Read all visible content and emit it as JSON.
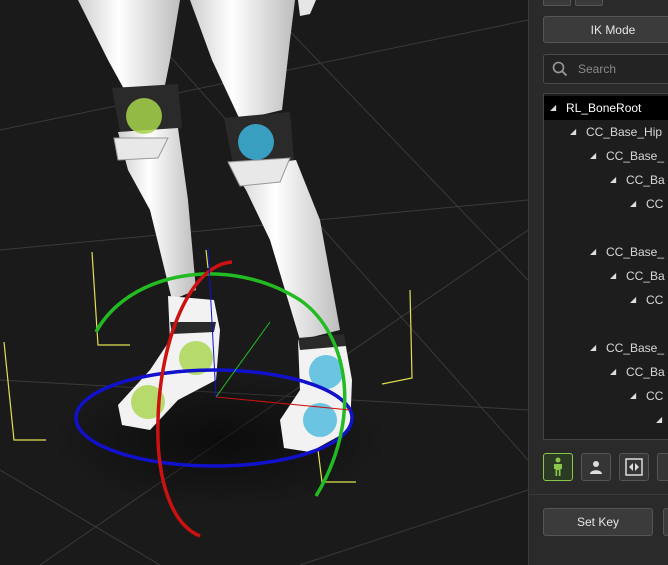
{
  "panel": {
    "top_tabs": [
      "",
      ""
    ],
    "ik_mode_label": "IK Mode",
    "search": {
      "placeholder": "Search",
      "value": ""
    },
    "tree": [
      {
        "label": "RL_BoneRoot",
        "selected": true
      },
      {
        "label": "CC_Base_Hip"
      },
      {
        "label": "CC_Base_"
      },
      {
        "label": "CC_Ba"
      },
      {
        "label": "CC"
      },
      {
        "label": ""
      },
      {
        "label": "CC_Base_"
      },
      {
        "label": "CC_Ba"
      },
      {
        "label": "CC"
      },
      {
        "label": ""
      },
      {
        "label": "CC_Base_"
      },
      {
        "label": "CC_Ba"
      },
      {
        "label": "CC"
      },
      {
        "label": ""
      }
    ],
    "toolbar_icons": [
      "body-figure-icon",
      "person-icon",
      "mirror-icon"
    ],
    "set_key_label": "Set Key"
  },
  "colors": {
    "accent_green": "#8ac64c",
    "gizmo_x": "#cc1111",
    "gizmo_y": "#22bb22",
    "gizmo_z": "#1111cc",
    "effector_green": "#a6d44a",
    "effector_blue": "#3cb4dc",
    "bound_box": "#e0e050"
  }
}
